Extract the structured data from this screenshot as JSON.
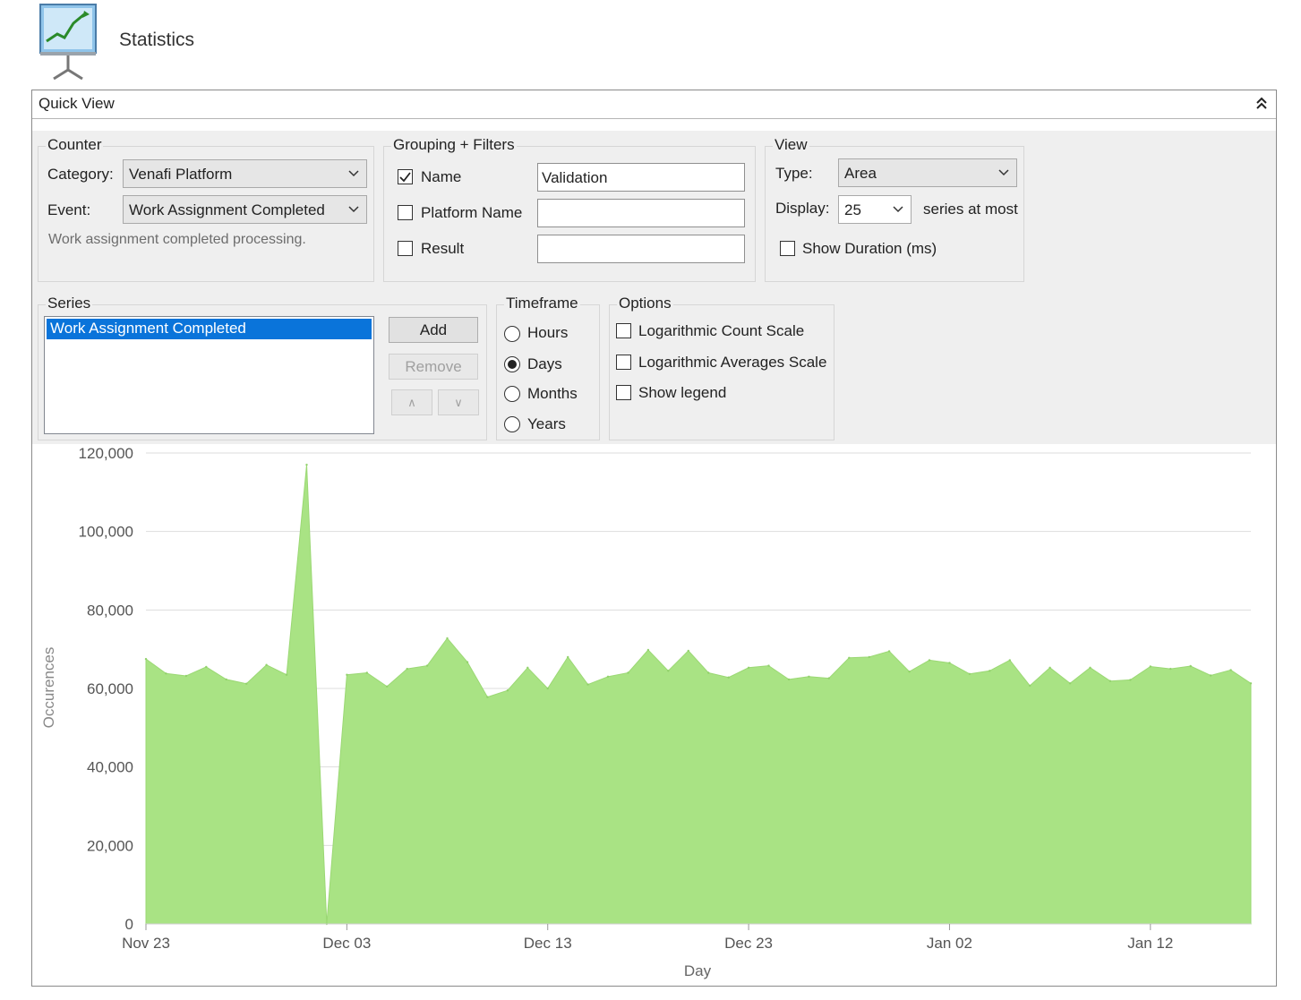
{
  "app": {
    "title": "Statistics",
    "icon": "chart-easel-icon"
  },
  "panel": {
    "title": "Quick View",
    "collapse_icon": "double-chevron-up-icon"
  },
  "counter": {
    "legend": "Counter",
    "category_label": "Category:",
    "category_value": "Venafi Platform",
    "event_label": "Event:",
    "event_value": "Work Assignment Completed",
    "description": "Work assignment completed processing."
  },
  "grouping": {
    "legend": "Grouping + Filters",
    "rows": [
      {
        "label": "Name",
        "checked": true,
        "value": "Validation"
      },
      {
        "label": "Platform Name",
        "checked": false,
        "value": ""
      },
      {
        "label": "Result",
        "checked": false,
        "value": ""
      }
    ]
  },
  "view": {
    "legend": "View",
    "type_label": "Type:",
    "type_value": "Area",
    "display_label": "Display:",
    "display_value": "25",
    "display_suffix": "series at most",
    "show_duration_label": "Show Duration (ms)",
    "show_duration_checked": false
  },
  "series": {
    "legend": "Series",
    "items": [
      "Work Assignment Completed"
    ],
    "add_label": "Add",
    "remove_label": "Remove",
    "up_label": "∧",
    "down_label": "∨"
  },
  "timeframe": {
    "legend": "Timeframe",
    "options": [
      "Hours",
      "Days",
      "Months",
      "Years"
    ],
    "selected": "Days"
  },
  "options": {
    "legend": "Options",
    "items": [
      {
        "label": "Logarithmic Count Scale",
        "checked": false
      },
      {
        "label": "Logarithmic Averages Scale",
        "checked": false
      },
      {
        "label": "Show legend",
        "checked": false
      }
    ]
  },
  "chart_data": {
    "type": "area",
    "xlabel": "Day",
    "ylabel": "Occurences",
    "ylim": [
      0,
      120000
    ],
    "yticks": [
      0,
      20000,
      40000,
      60000,
      80000,
      100000,
      120000
    ],
    "ytick_labels": [
      "0",
      "20,000",
      "40,000",
      "60,000",
      "80,000",
      "100,000",
      "120,000"
    ],
    "xtick_labels": [
      "Nov 23",
      "Dec 03",
      "Dec 13",
      "Dec 23",
      "Jan 02",
      "Jan 12"
    ],
    "x_start": "Nov 23",
    "color": "#a9e384",
    "grid": true,
    "series": [
      {
        "values": [
          67500,
          63800,
          63200,
          65500,
          62300,
          61200,
          66000,
          63500,
          117000,
          0,
          63500,
          64000,
          60500,
          65000,
          65800,
          72800,
          66700,
          57800,
          59500,
          65300,
          60000,
          68000,
          61000,
          63000,
          64000,
          69800,
          64500,
          69600,
          64000,
          62800,
          65300,
          65800,
          62300,
          63000,
          62600,
          67800,
          68000,
          69500,
          64300,
          67200,
          66500,
          63700,
          64500,
          67200,
          60700,
          65300,
          61300,
          65300,
          61900,
          62200,
          65600,
          65000,
          65700,
          63300,
          64700,
          61300
        ]
      }
    ]
  }
}
